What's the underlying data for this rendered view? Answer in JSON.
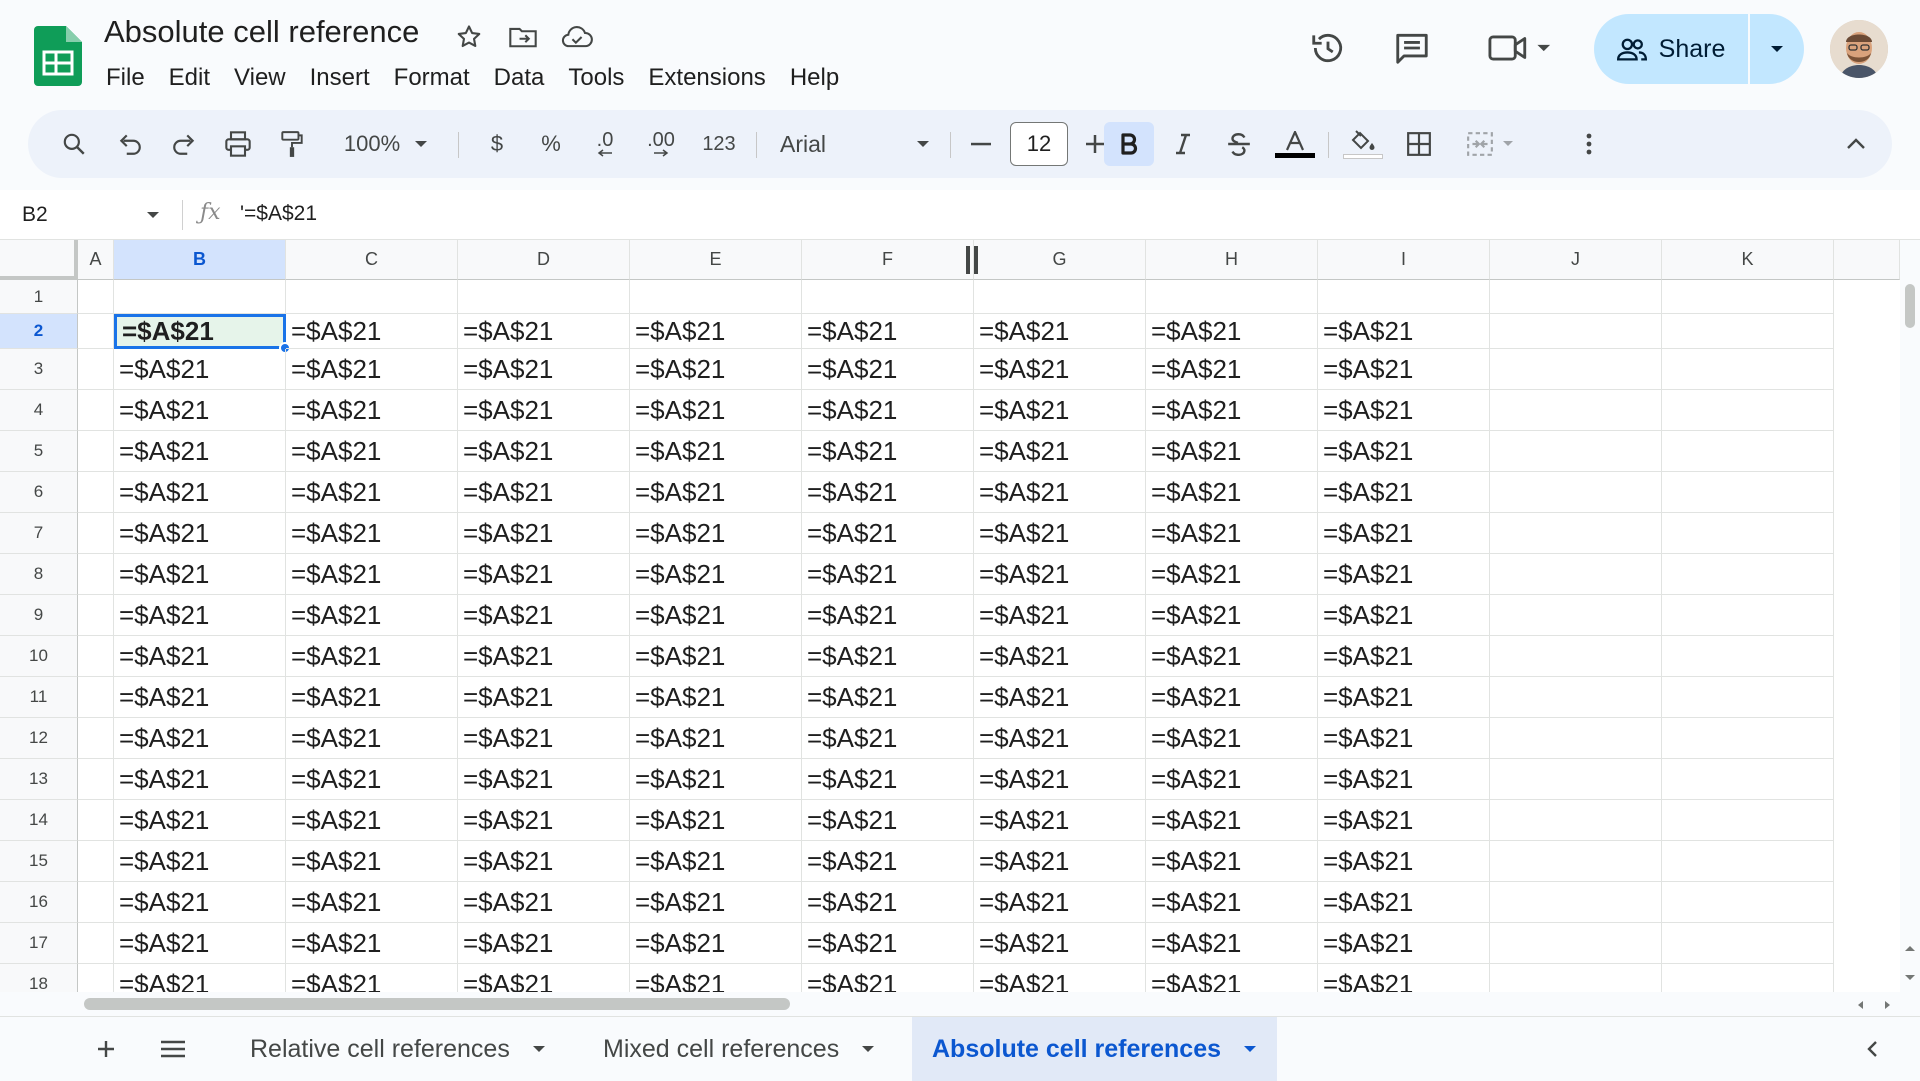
{
  "document": {
    "title": "Absolute cell reference"
  },
  "menu": [
    "File",
    "Edit",
    "View",
    "Insert",
    "Format",
    "Data",
    "Tools",
    "Extensions",
    "Help"
  ],
  "share": {
    "label": "Share"
  },
  "toolbar": {
    "zoom": "100%",
    "currency": "$",
    "percent": "%",
    "decrease_decimal": ".0",
    "increase_decimal": ".00",
    "number_format": "123",
    "font": "Arial",
    "font_size": "12"
  },
  "formula_bar": {
    "name_box": "B2",
    "formula": "'=$A$21"
  },
  "grid": {
    "columns": [
      "A",
      "B",
      "C",
      "D",
      "E",
      "F",
      "G",
      "H",
      "I",
      "J",
      "K"
    ],
    "rows": [
      "1",
      "2",
      "3",
      "4",
      "5",
      "6",
      "7",
      "8",
      "9",
      "10",
      "11",
      "12",
      "13",
      "14",
      "15",
      "16",
      "17",
      "18"
    ],
    "cell_text": "=$A$21",
    "filled_columns": [
      "B",
      "C",
      "D",
      "E",
      "F",
      "G",
      "H",
      "I"
    ],
    "first_filled_row": "2",
    "last_filled_row": "18",
    "active_cell": "B2"
  },
  "sheets": [
    {
      "name": "Relative cell references",
      "active": false
    },
    {
      "name": "Mixed cell references",
      "active": false
    },
    {
      "name": "Absolute cell references",
      "active": true
    }
  ],
  "colors": {
    "accent": "#1a73e8",
    "share_bg": "#c2e7ff",
    "selected_header": "#d3e3fd",
    "active_cell_fill": "#e6f4ea",
    "sheets_green": "#0f9d58"
  }
}
